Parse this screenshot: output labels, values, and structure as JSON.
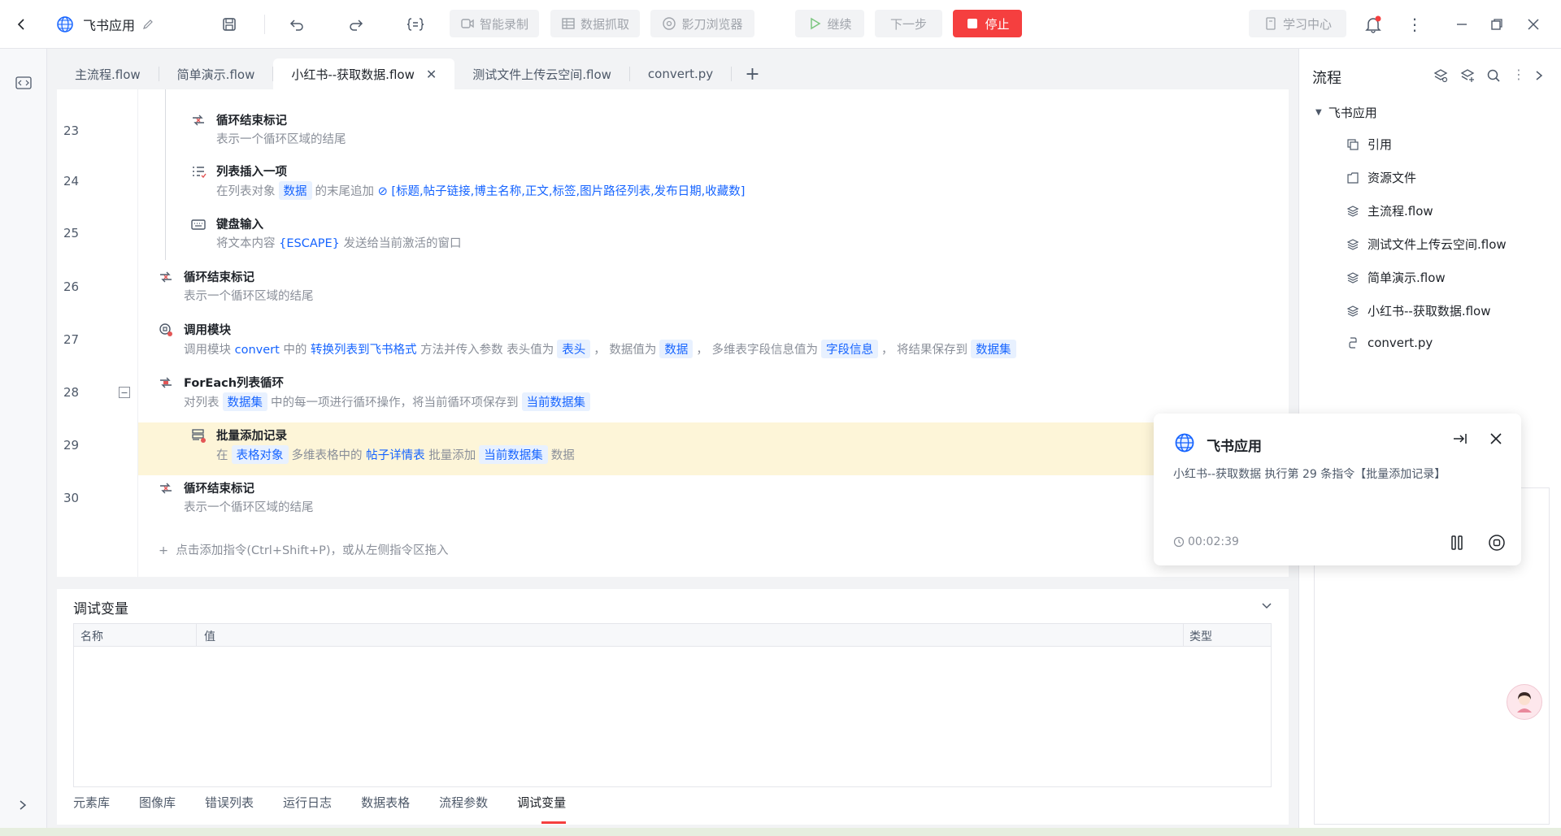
{
  "app": {
    "name": "飞书应用"
  },
  "toolbar": {
    "smart_record": "智能录制",
    "data_capture": "数据抓取",
    "shadow_browser": "影刀浏览器",
    "continue": "继续",
    "next_step": "下一步",
    "stop": "停止",
    "learn_center": "学习中心"
  },
  "tabs": [
    {
      "label": "主流程.flow"
    },
    {
      "label": "简单演示.flow"
    },
    {
      "label": "小红书--获取数据.flow"
    },
    {
      "label": "测试文件上传云空间.flow"
    },
    {
      "label": "convert.py"
    }
  ],
  "commands": {
    "r23": {
      "line": "23",
      "title": "循环结束标记",
      "desc": "表示一个循环区域的结尾"
    },
    "r24": {
      "line": "24",
      "title": "列表插入一项",
      "d1": "在列表对象",
      "t1": "数据",
      "d2": "的末尾追加",
      "t2": "[标题,帖子链接,博主名称,正文,标签,图片路径列表,发布日期,收藏数]"
    },
    "r25": {
      "line": "25",
      "title": "键盘输入",
      "d1": "将文本内容",
      "t1": "{ESCAPE}",
      "d2": "发送给当前激活的窗口"
    },
    "r26": {
      "line": "26",
      "title": "循环结束标记",
      "desc": "表示一个循环区域的结尾"
    },
    "r27": {
      "line": "27",
      "title": "调用模块",
      "d1": "调用模块",
      "t1": "convert",
      "d2": "中的",
      "t2": "转换列表到飞书格式",
      "d3": "方法并传入参数 表头值为",
      "t3": "表头",
      "d4": "，  数据值为",
      "t4": "数据",
      "d5": "，  多维表字段信息值为",
      "t5": "字段信息",
      "d6": "，  将结果保存到",
      "t6": "数据集"
    },
    "r28": {
      "line": "28",
      "title": "ForEach列表循环",
      "d1": "对列表",
      "t1": "数据集",
      "d2": "中的每一项进行循环操作，将当前循环项保存到",
      "t2": "当前数据集"
    },
    "r29": {
      "line": "29",
      "title": "批量添加记录",
      "d1": "在",
      "t1": "表格对象",
      "d2": "多维表格中的",
      "t2": "帖子详情表",
      "d3": "批量添加",
      "t3": "当前数据集",
      "d4": "数据"
    },
    "r30": {
      "line": "30",
      "title": "循环结束标记",
      "desc": "表示一个循环区域的结尾"
    }
  },
  "add_hint": "点击添加指令(Ctrl+Shift+P)，或从左侧指令区拖入",
  "debug": {
    "title": "调试变量",
    "columns": [
      "名称",
      "值",
      "类型"
    ],
    "bottom_tabs": [
      "元素库",
      "图像库",
      "错误列表",
      "运行日志",
      "数据表格",
      "流程参数",
      "调试变量"
    ]
  },
  "right_panel": {
    "title": "流程",
    "root": "飞书应用",
    "items": [
      "引用",
      "资源文件",
      "主流程.flow",
      "测试文件上传云空间.flow",
      "简单演示.flow",
      "小红书--获取数据.flow",
      "convert.py"
    ]
  },
  "popup": {
    "title": "飞书应用",
    "message": "小红书--获取数据 执行第 29 条指令【批量添加记录】",
    "time": "00:02:39"
  },
  "colors": {
    "stop": "#f53f3f",
    "link": "#1664ff",
    "highlight_row": "#fdf5d8"
  }
}
